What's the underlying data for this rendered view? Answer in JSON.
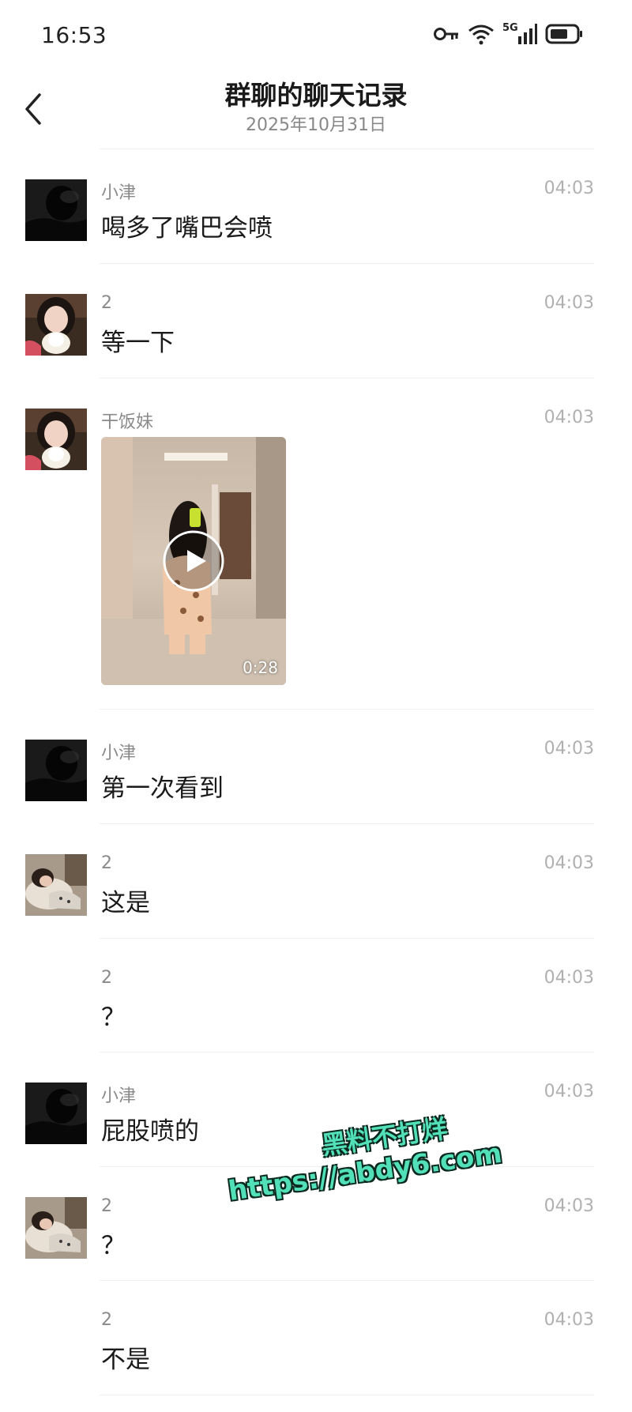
{
  "status_bar": {
    "time": "16:53",
    "network": "5G",
    "icons": [
      "key-icon",
      "wifi-icon",
      "signal-icon",
      "battery-icon"
    ]
  },
  "header": {
    "title": "群聊的聊天记录",
    "subtitle": "2025年10月31日"
  },
  "messages": [
    {
      "sender": "小津",
      "time": "04:03",
      "text": "喝多了嘴巴会喷",
      "avatar": "dark-silhouette"
    },
    {
      "sender": "2",
      "time": "04:03",
      "text": "等一下",
      "avatar": "girl-with-plush"
    },
    {
      "sender": "干饭妹",
      "time": "04:03",
      "type": "video",
      "duration": "0:28",
      "avatar": "girl-with-plush"
    },
    {
      "sender": "小津",
      "time": "04:03",
      "text": "第一次看到",
      "avatar": "dark-silhouette"
    },
    {
      "sender": "2",
      "time": "04:03",
      "text": "这是",
      "avatar": "lying-person"
    },
    {
      "sender": "2",
      "time": "04:03",
      "text": "？",
      "avatar": null
    },
    {
      "sender": "小津",
      "time": "04:03",
      "text": "屁股喷的",
      "avatar": "dark-silhouette"
    },
    {
      "sender": "2",
      "time": "04:03",
      "text": "？",
      "avatar": "lying-person"
    },
    {
      "sender": "2",
      "time": "04:03",
      "text": "不是",
      "avatar": null
    }
  ],
  "watermark": {
    "line1": "黑料不打烊",
    "line2": "https://abdy6.com",
    "color": "#52e0b8"
  }
}
